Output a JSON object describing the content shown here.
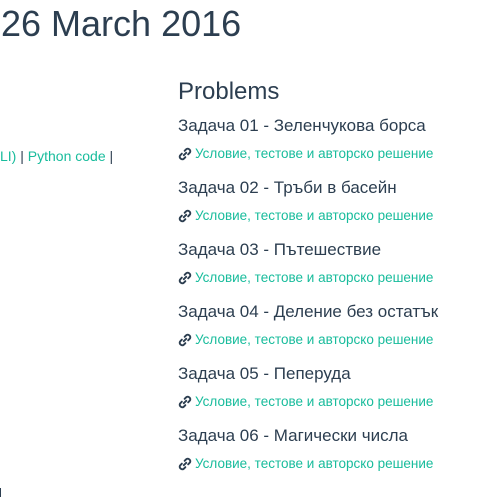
{
  "page": {
    "title": "26 March 2016"
  },
  "sidebar_links": {
    "prefix": "LI)",
    "separator_1": " | ",
    "python_code": "Python code",
    "separator_2": " |"
  },
  "problems": {
    "heading": "Problems",
    "items": [
      {
        "title": "Задача 01 - Зеленчукова борса",
        "link": "Условие, тестове и авторско решение"
      },
      {
        "title": "Задача 02 - Тръби в басейн",
        "link": "Условие, тестове и авторско решение"
      },
      {
        "title": "Задача 03 - Пътешествие",
        "link": "Условие, тестове и авторско решение"
      },
      {
        "title": "Задача 04 - Деление без остатък",
        "link": "Условие, тестове и авторско решение"
      },
      {
        "title": "Задача 05 - Пеперуда",
        "link": "Условие, тестове и авторско решение"
      },
      {
        "title": "Задача 06 - Магически числа",
        "link": "Условие, тестове и авторско решение"
      }
    ]
  },
  "colors": {
    "text": "#2c3e50",
    "link": "#18bc9c"
  },
  "icons": {
    "problem_link_icon": "chain-link-icon"
  }
}
